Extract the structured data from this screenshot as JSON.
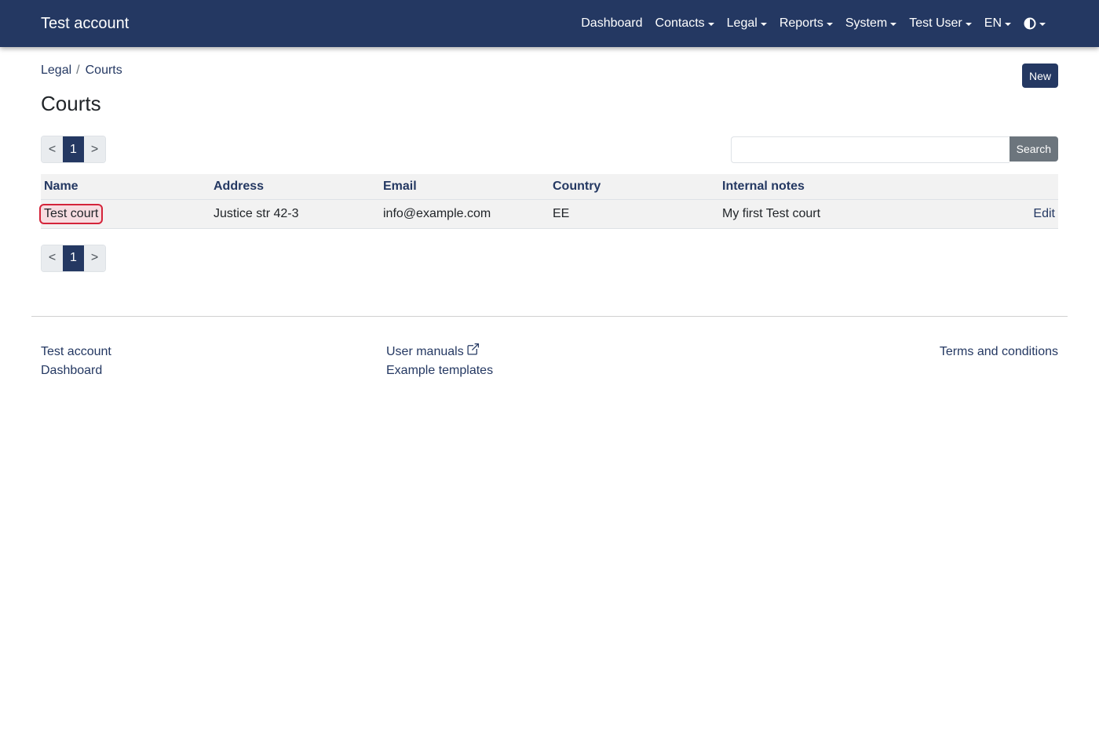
{
  "navbar": {
    "brand": "Test account",
    "items": [
      {
        "label": "Dashboard",
        "dropdown": false
      },
      {
        "label": "Contacts",
        "dropdown": true
      },
      {
        "label": "Legal",
        "dropdown": true
      },
      {
        "label": "Reports",
        "dropdown": true
      },
      {
        "label": "System",
        "dropdown": true
      },
      {
        "label": "Test User",
        "dropdown": true
      },
      {
        "label": "EN",
        "dropdown": true
      }
    ],
    "theme_icon": "contrast-half-circle-icon",
    "color": "#243862"
  },
  "breadcrumb": [
    "Legal",
    "Courts"
  ],
  "new_button": "New",
  "page_title": "Courts",
  "pagination": {
    "prev": "<",
    "current": "1",
    "next": ">"
  },
  "search": {
    "placeholder": "",
    "value": "",
    "button": "Search"
  },
  "table": {
    "columns": [
      "Name",
      "Address",
      "Email",
      "Country",
      "Internal notes",
      ""
    ],
    "rows": [
      {
        "name": "Test court",
        "address": "Justice str 42-3",
        "email": "info@example.com",
        "country": "EE",
        "notes": "My first Test court",
        "action": "Edit"
      }
    ]
  },
  "footer": {
    "col1": [
      "Test account",
      "Dashboard"
    ],
    "col2": [
      "User manuals",
      "Example templates"
    ],
    "col3": [
      "Terms and conditions"
    ],
    "external_icon": "external-link-icon"
  }
}
